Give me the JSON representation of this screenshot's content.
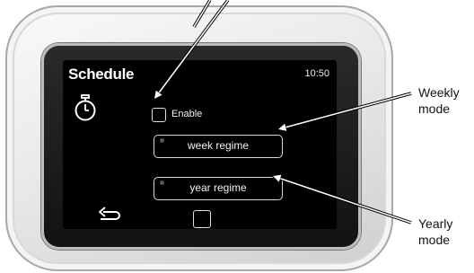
{
  "screen": {
    "title": "Schedule",
    "clock": "10:50",
    "enable_label": "Enable",
    "enable_checked": false,
    "week_button": "week regime",
    "year_button": "year regime",
    "icons": {
      "timer": "stopwatch-icon",
      "back": "back-arrow-icon",
      "home": "square-home-icon"
    }
  },
  "callouts": {
    "weekly": [
      "Weekly",
      "mode"
    ],
    "yearly": [
      "Yearly",
      "mode"
    ]
  },
  "colors": {
    "screen_bg": "#000000",
    "text": "#ffffff",
    "device_body": "#e9e9e9"
  }
}
